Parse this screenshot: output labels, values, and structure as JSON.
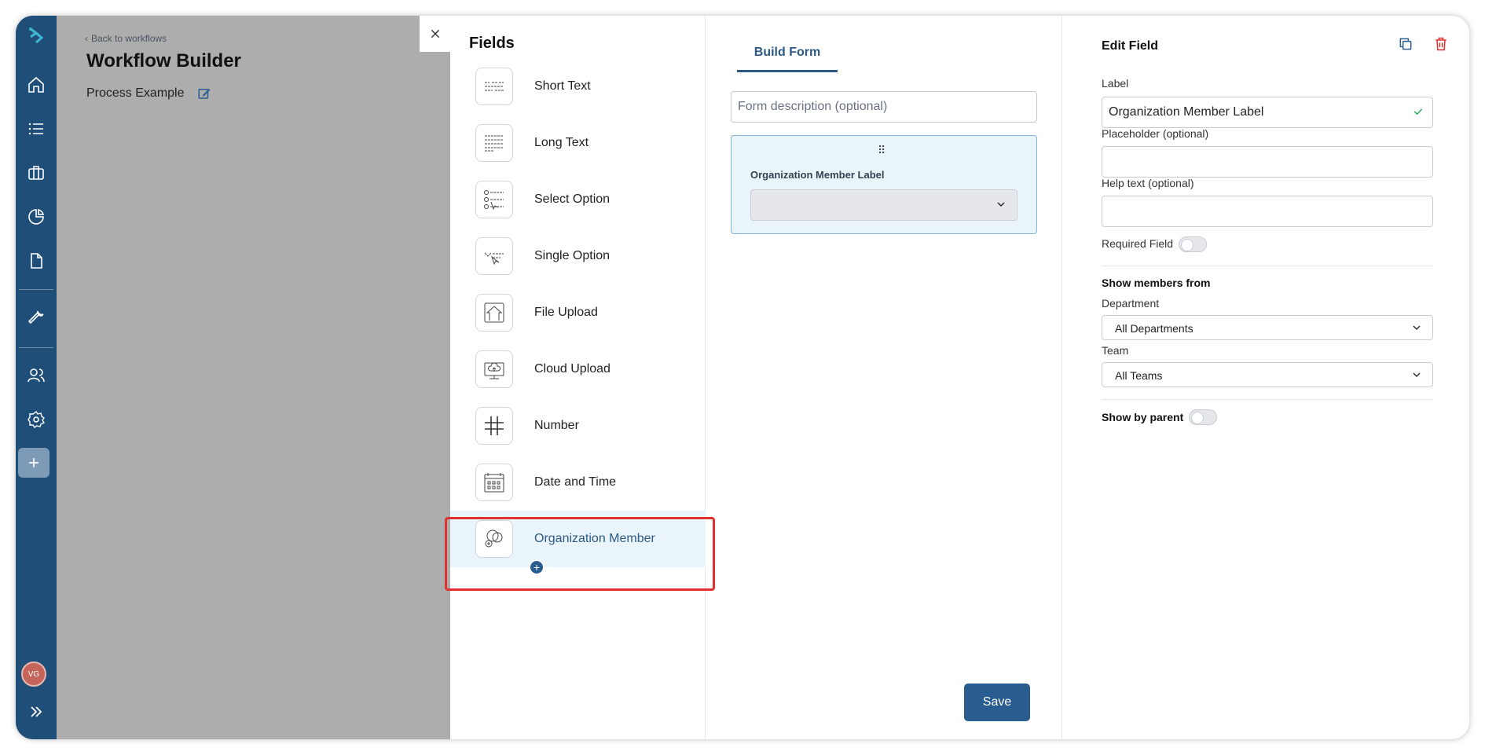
{
  "header": {
    "back_link": "Back to workflows",
    "title": "Workflow Builder",
    "process_name": "Process Example"
  },
  "fields_panel": {
    "title": "Fields",
    "items": [
      {
        "label": "Short Text",
        "icon": "short-text-icon"
      },
      {
        "label": "Long Text",
        "icon": "long-text-icon"
      },
      {
        "label": "Select Option",
        "icon": "select-option-icon"
      },
      {
        "label": "Single Option",
        "icon": "single-option-icon"
      },
      {
        "label": "File Upload",
        "icon": "file-upload-icon"
      },
      {
        "label": "Cloud Upload",
        "icon": "cloud-upload-icon"
      },
      {
        "label": "Number",
        "icon": "number-icon"
      },
      {
        "label": "Date and Time",
        "icon": "date-time-icon"
      },
      {
        "label": "Organization Member",
        "icon": "organization-member-icon"
      }
    ]
  },
  "build_form": {
    "tab": "Build Form",
    "description_placeholder": "Form description (optional)",
    "field_label": "Organization Member Label",
    "save_label": "Save"
  },
  "edit_field": {
    "title": "Edit Field",
    "label_title": "Label",
    "label_value": "Organization Member Label",
    "placeholder_title": "Placeholder (optional)",
    "help_title": "Help text (optional)",
    "required_label": "Required Field",
    "show_members_title": "Show members from",
    "department_title": "Department",
    "department_value": "All Departments",
    "team_title": "Team",
    "team_value": "All Teams",
    "show_by_parent_label": "Show by parent"
  },
  "user": {
    "initials": "VG"
  },
  "colors": {
    "nav": "#1f4e79",
    "accent": "#2a5d8f",
    "highlight": "#e03131",
    "delete": "#e03131"
  }
}
